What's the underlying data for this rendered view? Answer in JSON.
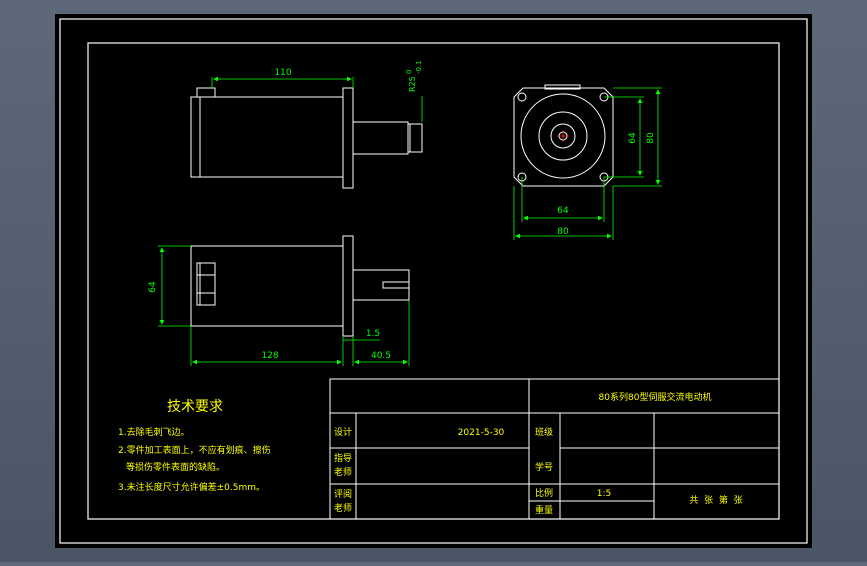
{
  "colors": {
    "background": "#000000",
    "frame": "#ffffff",
    "dimension": "#00ff00",
    "text_title_block": "#ffff00",
    "notes": "#ffff00"
  },
  "views": {
    "side_top": {
      "length_dim": "110",
      "shaft_dims": [
        "0",
        "R25",
        "-0.1"
      ]
    },
    "front": {
      "inner_dim": "64",
      "outer_dim": "80",
      "bottom_inner_dim": "64",
      "bottom_outer_dim": "80"
    },
    "side_bottom": {
      "height_dim": "64",
      "body_length_dim": "128",
      "flange_dim": "1.5",
      "shaft_length_dim": "40.5"
    }
  },
  "notes": {
    "title": "技术要求",
    "items": [
      "1.去除毛刺飞边。",
      "2.零件加工表面上，不应有划痕、擦伤",
      "  等损伤零件表面的缺陷。",
      "3.未注长度尺寸允许偏差±0.5mm。"
    ]
  },
  "title_block": {
    "drawing_name": "80系列80型伺服交流电动机",
    "designer_label": "设计",
    "date": "2021-5-30",
    "standard_label": "班级",
    "instructor_label_1": "指导",
    "instructor_label_2": "老师",
    "student_id_label": "学号",
    "reviewer_label_1": "评阅",
    "reviewer_label_2": "老师",
    "scale_label": "比例",
    "scale_value": "1:5",
    "weight_label": "重量",
    "sheets_text": "共  张  第  张"
  }
}
